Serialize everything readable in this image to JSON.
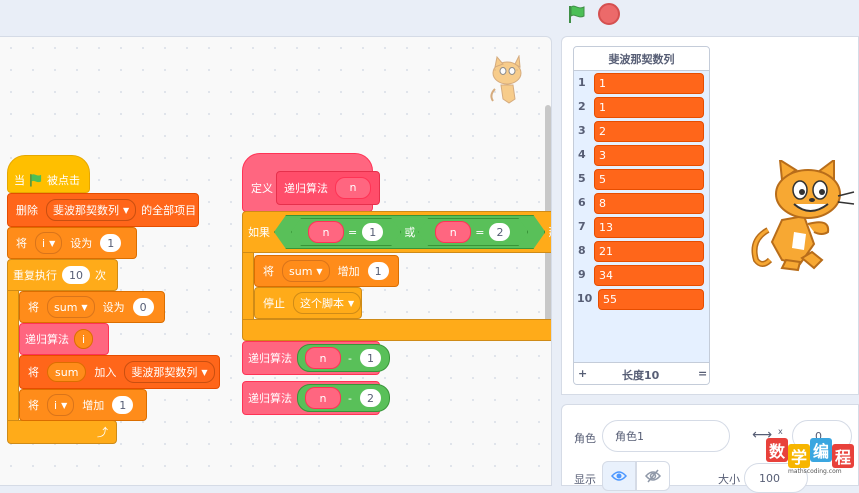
{
  "colors": {
    "event": "#ffbf00",
    "list": "#ff661a",
    "variable": "#ff8c1a",
    "control": "#ffab19",
    "myblock": "#ff6680",
    "operator": "#59c059",
    "stop": "#ec6a6a",
    "flag": "#4cbf56"
  },
  "toolbar": {
    "green_flag_icon": "green-flag-icon",
    "stop_icon": "stop-sign-icon"
  },
  "script1": {
    "when": "当",
    "clicked": "被点击",
    "delete": "删除",
    "delete_list": "斐波那契数列",
    "delete_all": "的全部项目",
    "set": "将",
    "set_var": "i",
    "set_to": "设为",
    "set_val": "1",
    "repeat": "重复执行",
    "repeat_val": "10",
    "repeat_times": "次",
    "set2": "将",
    "set2_var": "sum",
    "set2_to": "设为",
    "set2_val": "0",
    "call": "递归算法",
    "call_arg": "i",
    "add": "将",
    "add_var": "sum",
    "add_to": "加入",
    "add_list": "斐波那契数列",
    "change": "将",
    "change_var": "i",
    "change_by": "增加",
    "change_val": "1"
  },
  "script2": {
    "define": "定义",
    "define_name": "递归算法",
    "define_param": "n",
    "if": "如果",
    "n1": "n",
    "eq1": "=",
    "v1": "1",
    "or": "或",
    "n2": "n",
    "eq2": "=",
    "v2": "2",
    "then": "那么",
    "c_set": "将",
    "c_var": "sum",
    "c_by": "增加",
    "c_val": "1",
    "stop": "停止",
    "stop_opt": "这个脚本",
    "r1": "递归算法",
    "r1_n": "n",
    "r1_op": "-",
    "r1_v": "1",
    "r2": "递归算法",
    "r2_n": "n",
    "r2_op": "-",
    "r2_v": "2"
  },
  "list_monitor": {
    "title": "斐波那契数列",
    "items": [
      {
        "index": "1",
        "value": "1"
      },
      {
        "index": "2",
        "value": "1"
      },
      {
        "index": "3",
        "value": "2"
      },
      {
        "index": "4",
        "value": "3"
      },
      {
        "index": "5",
        "value": "5"
      },
      {
        "index": "6",
        "value": "8"
      },
      {
        "index": "7",
        "value": "13"
      },
      {
        "index": "8",
        "value": "21"
      },
      {
        "index": "9",
        "value": "34"
      },
      {
        "index": "10",
        "value": "55"
      }
    ],
    "add": "+",
    "length": "长度10",
    "resize": "="
  },
  "sprite_info": {
    "sprite_label": "角色",
    "sprite_name": "角色1",
    "x_label": "x",
    "x_value": "0",
    "show_label": "显示",
    "size_label": "大小",
    "size_value": "100"
  },
  "watermark": {
    "c1": "数",
    "c2": "学",
    "c3": "编",
    "c4": "程",
    "url": "mathscoding.com"
  }
}
